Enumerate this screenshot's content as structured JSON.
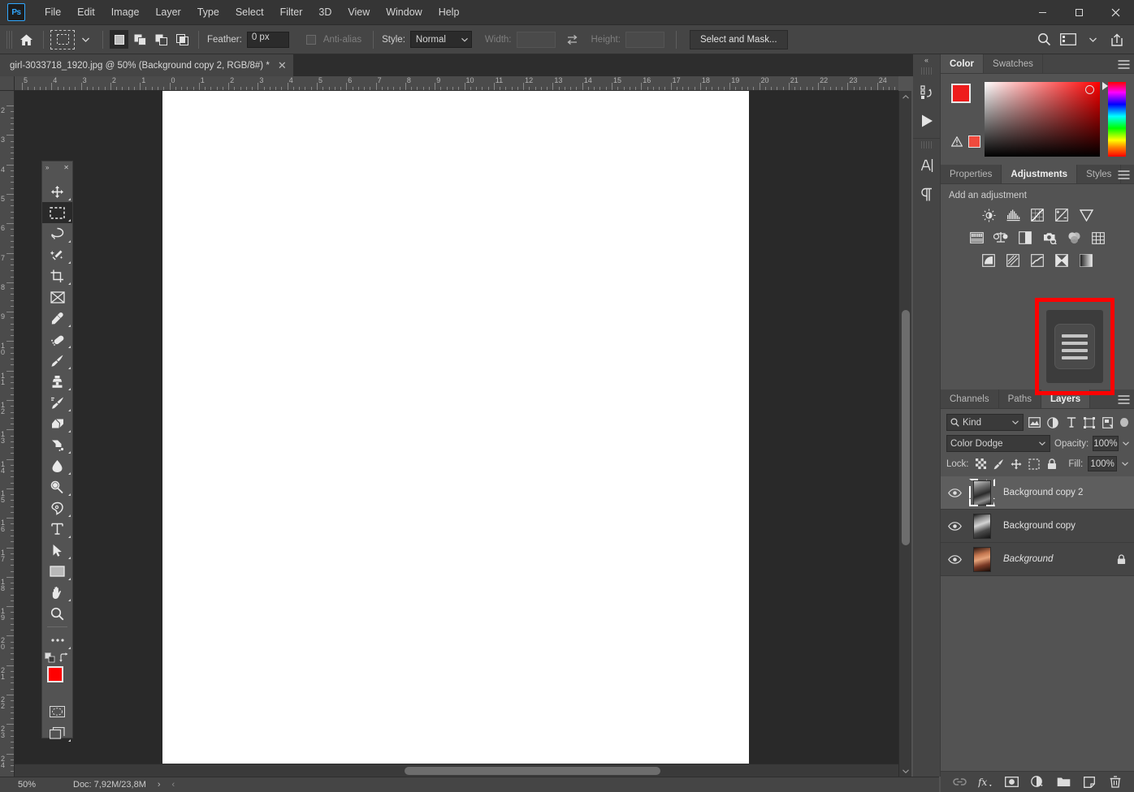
{
  "app": {
    "name": "Adobe Photoshop",
    "logo_text": "Ps"
  },
  "menubar": {
    "items": [
      {
        "label": "File"
      },
      {
        "label": "Edit"
      },
      {
        "label": "Image"
      },
      {
        "label": "Layer"
      },
      {
        "label": "Type"
      },
      {
        "label": "Select"
      },
      {
        "label": "Filter"
      },
      {
        "label": "3D"
      },
      {
        "label": "View"
      },
      {
        "label": "Window"
      },
      {
        "label": "Help"
      }
    ],
    "window_controls": {
      "minimize": "—",
      "maximize": "❐",
      "close": "✕"
    }
  },
  "options_bar": {
    "home_icon": "home-icon",
    "active_tool": "rectangular-marquee-tool",
    "selection_modes": [
      "new-selection",
      "add-to-selection",
      "subtract-from-selection",
      "intersect-with-selection"
    ],
    "feather_label": "Feather:",
    "feather_value": "0 px",
    "antialias_label": "Anti-alias",
    "antialias_checked": false,
    "style_label": "Style:",
    "style_value": "Normal",
    "width_label": "Width:",
    "width_value": "",
    "height_label": "Height:",
    "height_value": "",
    "select_and_mask_label": "Select and Mask...",
    "right_icons": [
      "search-icon",
      "workspace-icon",
      "chevron-down-icon",
      "share-icon"
    ]
  },
  "document_tab": {
    "title": "girl-3033718_1920.jpg @ 50% (Background copy 2, RGB/8#) *",
    "close_glyph": "✕"
  },
  "rulers": {
    "unit": "cm",
    "horizontal_labels": [
      "5",
      "4",
      "3",
      "2",
      "1",
      "0",
      "1",
      "2",
      "3",
      "4",
      "5",
      "6",
      "7",
      "8",
      "9",
      "10",
      "11",
      "12",
      "13",
      "14",
      "15",
      "16",
      "17",
      "18",
      "19",
      "20",
      "21",
      "22",
      "23",
      "24"
    ],
    "vertical_labels": [
      "2",
      "3",
      "4",
      "5",
      "6",
      "7",
      "8",
      "9",
      "10",
      "11",
      "12",
      "13",
      "14",
      "15",
      "16",
      "17",
      "18",
      "19",
      "20",
      "21",
      "22",
      "23",
      "24"
    ]
  },
  "canvas": {
    "artboard_color": "#ffffff",
    "background_color": "#292929"
  },
  "status_bar": {
    "zoom": "50%",
    "doc_info": "Doc: 7,92M/23,8M",
    "arrow_right": "›",
    "arrow_left": "‹"
  },
  "toolbar": {
    "collapse_glyph": "»",
    "close_glyph": "✕",
    "tools": [
      {
        "name": "move-tool",
        "has_flyout": true
      },
      {
        "name": "rectangular-marquee-tool",
        "has_flyout": true,
        "active": true
      },
      {
        "name": "lasso-tool",
        "has_flyout": true
      },
      {
        "name": "quick-selection-tool",
        "has_flyout": true
      },
      {
        "name": "crop-tool",
        "has_flyout": true
      },
      {
        "name": "frame-tool",
        "has_flyout": false
      },
      {
        "name": "eyedropper-tool",
        "has_flyout": true
      },
      {
        "name": "spot-healing-brush-tool",
        "has_flyout": true
      },
      {
        "name": "brush-tool",
        "has_flyout": true
      },
      {
        "name": "clone-stamp-tool",
        "has_flyout": true
      },
      {
        "name": "history-brush-tool",
        "has_flyout": true
      },
      {
        "name": "eraser-tool",
        "has_flyout": true
      },
      {
        "name": "gradient-tool",
        "has_flyout": true
      },
      {
        "name": "blur-tool",
        "has_flyout": true
      },
      {
        "name": "dodge-tool",
        "has_flyout": true
      },
      {
        "name": "pen-tool",
        "has_flyout": true
      },
      {
        "name": "type-tool",
        "has_flyout": true
      },
      {
        "name": "path-selection-tool",
        "has_flyout": true
      },
      {
        "name": "rectangle-tool",
        "has_flyout": true
      },
      {
        "name": "hand-tool",
        "has_flyout": true
      },
      {
        "name": "zoom-tool",
        "has_flyout": false
      },
      {
        "name": "edit-toolbar-tool",
        "has_flyout": true
      }
    ],
    "foreground_color": "#ff0000",
    "background_color": "#ff0000",
    "default_colors_icon": "default-colors-icon",
    "swap_colors_icon": "swap-colors-icon",
    "quick_mask_icon": "quick-mask-icon",
    "screen_mode_icon": "screen-mode-icon"
  },
  "icon_dock": {
    "collapse_glyph": "«",
    "icons": [
      "history-icon",
      "play-icon",
      "character-icon",
      "paragraph-icon"
    ]
  },
  "color_panel": {
    "tabs": [
      {
        "label": "Color",
        "active": true
      },
      {
        "label": "Swatches",
        "active": false
      }
    ],
    "menu_icon": "panel-menu-icon",
    "foreground": "#ee1c1c",
    "background": "#ee1c1c",
    "warning_icon": "out-of-gamut-warning-icon",
    "warning_swatch": "#f04a3d"
  },
  "adjustments_panel": {
    "tabs": [
      {
        "label": "Properties",
        "active": false
      },
      {
        "label": "Adjustments",
        "active": true
      },
      {
        "label": "Styles",
        "active": false
      }
    ],
    "menu_icon": "panel-menu-icon",
    "title": "Add an adjustment",
    "rows": [
      [
        "brightness-contrast-icon",
        "levels-icon",
        "curves-icon",
        "exposure-icon",
        "vibrance-icon"
      ],
      [
        "hue-saturation-icon",
        "color-balance-icon",
        "black-white-icon",
        "photo-filter-icon",
        "channel-mixer-icon",
        "color-lookup-icon"
      ],
      [
        "invert-icon",
        "posterize-icon",
        "threshold-icon",
        "gradient-map-icon",
        "selective-color-icon"
      ]
    ]
  },
  "highlight": {
    "color": "#ff0000",
    "target": "panel-menu-highlight"
  },
  "layers_panel": {
    "tabs": [
      {
        "label": "Channels",
        "active": false
      },
      {
        "label": "Paths",
        "active": false
      },
      {
        "label": "Layers",
        "active": true
      }
    ],
    "menu_icon": "panel-menu-icon",
    "filter": {
      "kind_label": "Kind",
      "search_icon": "search-icon",
      "filter_icons": [
        "filter-pixel-icon",
        "filter-adjustment-icon",
        "filter-type-icon",
        "filter-shape-icon",
        "filter-smart-object-icon"
      ],
      "toggle_icon": "filter-toggle-icon"
    },
    "blend_mode": "Color Dodge",
    "opacity_label": "Opacity:",
    "opacity_value": "100%",
    "lock_label": "Lock:",
    "lock_icons": [
      "lock-transparent-pixels-icon",
      "lock-image-pixels-icon",
      "lock-position-icon",
      "lock-artboard-nesting-icon",
      "lock-all-icon"
    ],
    "fill_label": "Fill:",
    "fill_value": "100%",
    "layers": [
      {
        "name": "Background copy 2",
        "visible": true,
        "selected": true,
        "locked": false,
        "italic": false,
        "thumb": "grayscale-portrait"
      },
      {
        "name": "Background copy",
        "visible": true,
        "selected": false,
        "locked": false,
        "italic": false,
        "thumb": "grayscale-portrait"
      },
      {
        "name": "Background",
        "visible": true,
        "selected": false,
        "locked": true,
        "italic": true,
        "thumb": "color-portrait"
      }
    ],
    "footer_icons": [
      "link-layers-icon",
      "layer-style-fx-icon",
      "add-layer-mask-icon",
      "new-adjustment-layer-icon",
      "new-group-icon",
      "new-layer-icon",
      "delete-layer-icon"
    ]
  }
}
